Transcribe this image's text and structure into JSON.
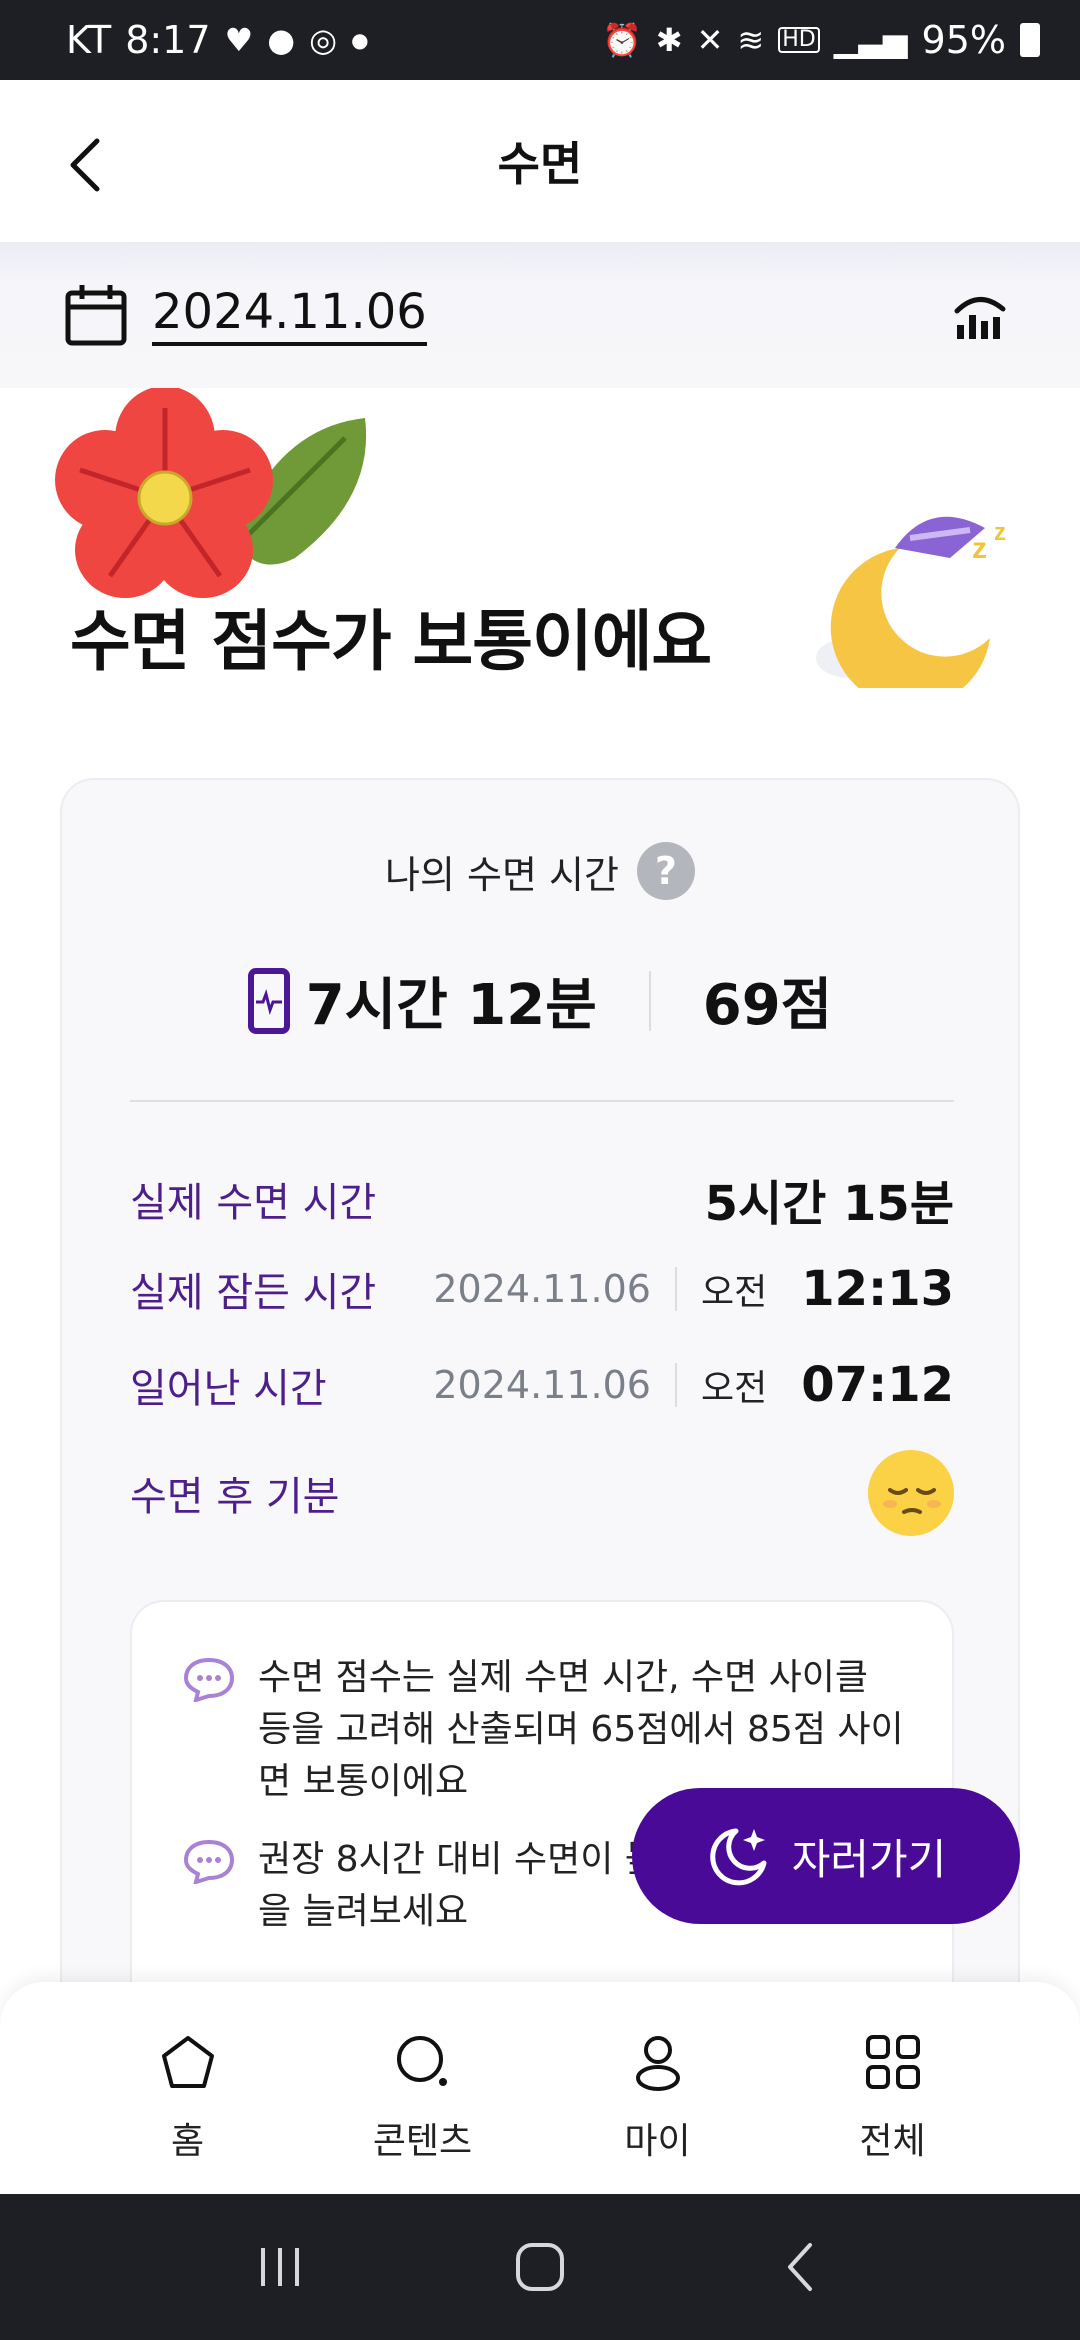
{
  "status_bar": {
    "carrier": "KT",
    "time": "8:17",
    "battery": "95%"
  },
  "header": {
    "title": "수면"
  },
  "date_bar": {
    "date": "2024.11.06"
  },
  "hero": {
    "line1": "",
    "title": "수면 점수가 보통이에요"
  },
  "summary": {
    "heading": "나의 수면 시간",
    "help": "?",
    "total_time": "7시간 12분",
    "score": "69점"
  },
  "details": [
    {
      "label": "실제 수면 시간",
      "value": "5시간 15분"
    },
    {
      "label": "실제 잠든 시간",
      "date": "2024.11.06",
      "ampm": "오전",
      "value": "12:13"
    },
    {
      "label": "일어난 시간",
      "date": "2024.11.06",
      "ampm": "오전",
      "value": "07:12"
    },
    {
      "label": "수면 후 기분"
    }
  ],
  "info": [
    {
      "text": "수면 점수는 실제 수면 시간, 수면 사이클 등을 고려해 산출되며 65점에서 85점 사이면 보통이에요"
    },
    {
      "text": "권장 8시간 대비 수면이 높이려면 수면시간을 늘려보세요"
    }
  ],
  "fab": {
    "label": "자러가기"
  },
  "bottom_nav": [
    {
      "label": "홈",
      "icon": "home-icon"
    },
    {
      "label": "콘텐츠",
      "icon": "search-icon"
    },
    {
      "label": "마이",
      "icon": "person-icon"
    },
    {
      "label": "전체",
      "icon": "grid-icon"
    }
  ],
  "colors": {
    "accent": "#4a0a98",
    "label_purple": "#4d1f8a",
    "mood_yellow": "#fbd146"
  }
}
